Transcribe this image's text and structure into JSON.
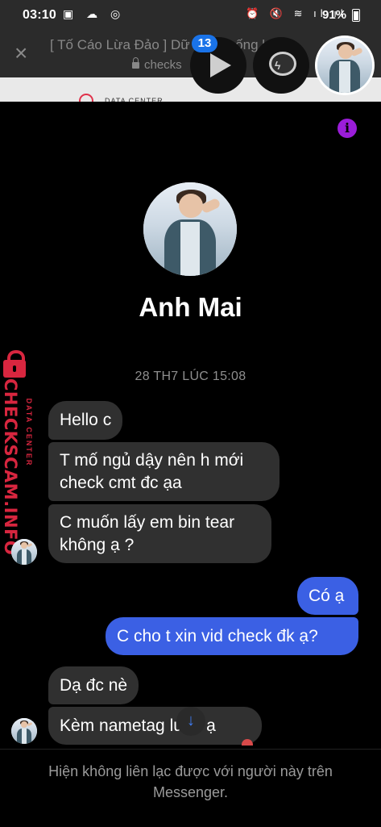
{
  "status_bar": {
    "time": "03:10",
    "left_icons": "▣ ☁ ◎",
    "right_icons": "⏰ 🔇 ≋ ıl ıl",
    "battery": "91%"
  },
  "browser": {
    "close_label": "×",
    "title": "[ Tố Cáo Lừa Đảo ] Dữ",
    "title_tail": "thống kê",
    "url": "checks"
  },
  "page_behind": {
    "strip_text": "DATA CENTER"
  },
  "chat_heads": {
    "badge_count": "13"
  },
  "profile": {
    "name": "Anh Mai",
    "info_label": "i"
  },
  "conversation": {
    "timestamp": "28 TH7 LÚC 15:08",
    "messages": [
      {
        "from": "them",
        "text": "Hello c"
      },
      {
        "from": "them",
        "text": "T mố ngủ dậy nên h mới check cmt đc ạa"
      },
      {
        "from": "them",
        "text": "C muốn lấy em bin tear không ạ ?"
      },
      {
        "from": "me",
        "text": "Có ạ"
      },
      {
        "from": "me",
        "text": "C cho t xin vid check đk ạ?"
      },
      {
        "from": "them",
        "text": "Dạ đc nè"
      },
      {
        "from": "them",
        "text": "Kèm nametag luôn ạ"
      }
    ]
  },
  "watermark": {
    "small": "DATA CENTER",
    "big": "CHECKSCAM.INFO",
    "color": "#d8263f"
  },
  "footer": {
    "text": "Hiện không liên lạc được với người này trên Messenger."
  },
  "colors": {
    "outgoing_bubble": "#3b60e4",
    "incoming_bubble": "#303030",
    "info_icon": "#9b1dd9"
  }
}
